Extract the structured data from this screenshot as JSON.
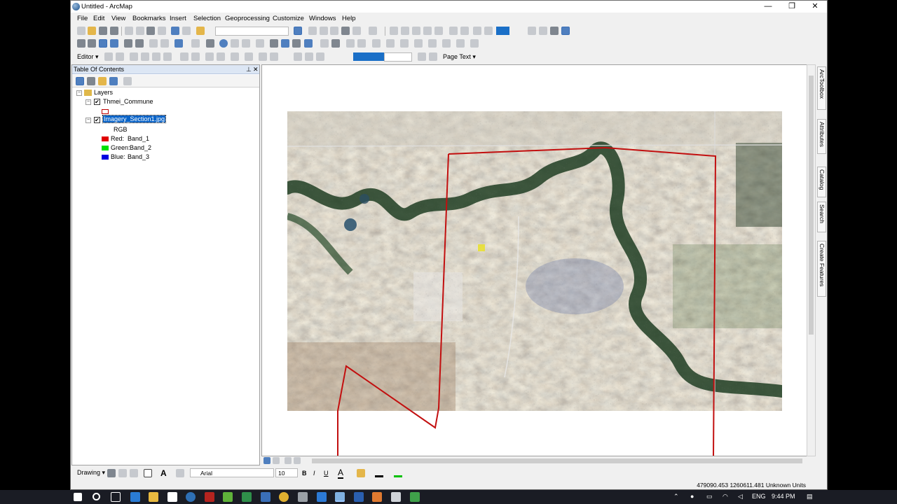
{
  "window": {
    "title": "Untitled - ArcMap",
    "minimize": "—",
    "restore": "❐",
    "close": "✕"
  },
  "menu": [
    "File",
    "Edit",
    "View",
    "Bookmarks",
    "Insert",
    "Selection",
    "Geoprocessing",
    "Customize",
    "Windows",
    "Help"
  ],
  "toolbars": {
    "editor_label": "Editor ▾",
    "layout_text_label": "Page Text ▾"
  },
  "toc": {
    "title": "Table Of Contents",
    "pin": "⊥",
    "close": "✕",
    "root": "Layers",
    "layers": [
      {
        "name": "Thmei_Commune",
        "checked": true,
        "legend": [
          {
            "type": "outline",
            "color": "#c00000",
            "label": ""
          }
        ]
      },
      {
        "name": "Imagery_Section1.jpg",
        "checked": true,
        "selected": true,
        "sublabel": "RGB",
        "legend": [
          {
            "color": "#e00000",
            "label": "Red:",
            "value": "Band_1"
          },
          {
            "color": "#00e000",
            "label": "Green:",
            "value": "Band_2"
          },
          {
            "color": "#0000e0",
            "label": "Blue:",
            "value": "Band_3"
          }
        ]
      }
    ]
  },
  "right_dock": [
    "ArcToolbox",
    "Attributes",
    "Catalog",
    "Search",
    "Create Features"
  ],
  "drawing": {
    "label": "Drawing ▾",
    "font": "Arial",
    "font_size": "10",
    "bold": "B",
    "italic": "I",
    "underline": "U",
    "text_a": "A"
  },
  "status": {
    "coords": "479090.453  1260611.481 Unknown Units"
  },
  "taskbar": {
    "lang": "ENG",
    "time": "9:44 PM"
  },
  "colors": {
    "boundary": "#c20f0f",
    "selection": "#0a64c8"
  }
}
